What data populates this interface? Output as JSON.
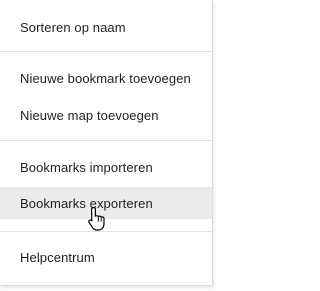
{
  "menu": {
    "items": [
      {
        "label": "Sorteren op naam"
      },
      {
        "label": "Nieuwe bookmark toevoegen"
      },
      {
        "label": "Nieuwe map toevoegen"
      },
      {
        "label": "Bookmarks importeren"
      },
      {
        "label": "Bookmarks exporteren",
        "hovered": true
      },
      {
        "label": "Helpcentrum"
      }
    ]
  },
  "cursor": {
    "icon": "hand-pointer-icon"
  },
  "colors": {
    "hover_background": "#ebebeb",
    "separator": "#e3e3e3"
  }
}
